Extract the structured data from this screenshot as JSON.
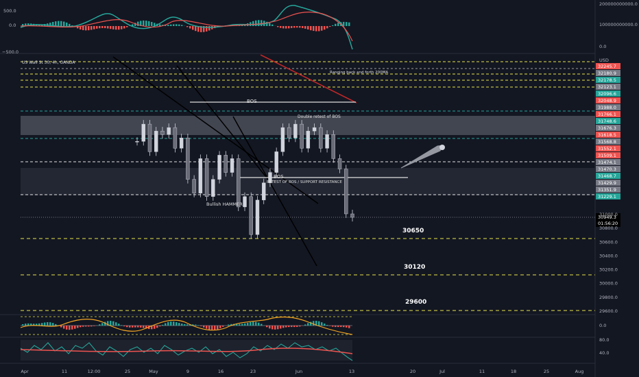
{
  "chart_data": {
    "type": "candlestick",
    "symbol": "US Wall St 30, 4h, OANDA",
    "currency": "USD",
    "x_axis_labels": [
      "Apr",
      "11",
      "12:00",
      "25",
      "May",
      "9",
      "16",
      "23",
      "Jun",
      "13",
      "20",
      "Jul",
      "11",
      "18",
      "25",
      "Aug"
    ],
    "price_axis_labels": [
      "31600.0",
      "31400.0",
      "31200.0",
      "31000.0",
      "30800.0",
      "30600.0",
      "30400.0",
      "30200.0",
      "30000.0",
      "29800.0",
      "29600.0"
    ],
    "price_tags": [
      {
        "label": "32245.7",
        "color": "#ef5350"
      },
      {
        "label": "32180.9",
        "color": "#787b86"
      },
      {
        "label": "32178.5",
        "color": "#26a69a"
      },
      {
        "label": "32123.1",
        "color": "#787b86"
      },
      {
        "label": "32096.6",
        "color": "#26a69a"
      },
      {
        "label": "32048.9",
        "color": "#ef5350"
      },
      {
        "label": "31988.0",
        "color": "#787b86"
      },
      {
        "label": "31766.1",
        "color": "#ef5350"
      },
      {
        "label": "31748.6",
        "color": "#26a69a"
      },
      {
        "label": "31676.3",
        "color": "#787b86"
      },
      {
        "label": "31618.5",
        "color": "#ef5350"
      },
      {
        "label": "31568.8",
        "color": "#787b86"
      },
      {
        "label": "31552.1",
        "color": "#ef5350"
      },
      {
        "label": "31509.1",
        "color": "#ef5350"
      },
      {
        "label": "31474.1",
        "color": "#787b86"
      },
      {
        "label": "31470.3",
        "color": "#787b86"
      },
      {
        "label": "31468.7",
        "color": "#26a69a"
      },
      {
        "label": "31429.9",
        "color": "#787b86"
      },
      {
        "label": "31351.9",
        "color": "#787b86"
      },
      {
        "label": "31229.1",
        "color": "#26a69a"
      }
    ],
    "current_price": "30949.3",
    "countdown": "01:56:20",
    "support_levels": [
      "30650",
      "30120",
      "29600"
    ],
    "annotations": {
      "bos_top": "BOS",
      "bos_mid": "BOS",
      "double_retest": "Double retest of BOS",
      "retest": "RETEST OF BOS / SUPPORT RESISTANCE",
      "hammer": "Bullish HAMMER",
      "ranging": "Ranging back and forth 200MA"
    },
    "macd": {
      "axis_labels": [
        "200000000000.0",
        "100000000000.0",
        "0.0"
      ],
      "left_labels": [
        "500.0",
        "0.0",
        "−500.0"
      ]
    },
    "oscillator": {
      "axis_label": "0.0"
    },
    "rsi": {
      "axis_labels": [
        "80.0",
        "40.0"
      ]
    },
    "price_path": [
      [
        "Apr 26",
        32050
      ],
      [
        "Apr 27",
        32300
      ],
      [
        "Apr 28",
        31900
      ],
      [
        "Apr 29",
        32200
      ],
      [
        "May 2",
        32150
      ],
      [
        "May 3",
        32250
      ],
      [
        "May 4",
        31950
      ],
      [
        "May 5",
        32100
      ],
      [
        "May 6",
        31500
      ],
      [
        "May 9",
        31300
      ],
      [
        "May 10",
        31800
      ],
      [
        "May 11",
        31250
      ],
      [
        "May 12",
        31500
      ],
      [
        "May 13",
        31850
      ],
      [
        "May 16",
        31600
      ],
      [
        "May 17",
        31800
      ],
      [
        "May 18",
        31100
      ],
      [
        "May 19",
        31250
      ],
      [
        "May 20",
        30700
      ],
      [
        "May 23",
        31200
      ],
      [
        "May 24",
        31450
      ],
      [
        "May 25",
        31600
      ],
      [
        "May 26",
        31900
      ],
      [
        "May 27",
        32250
      ],
      [
        "May 30",
        32100
      ],
      [
        "May 31",
        32300
      ],
      [
        "Jun 1",
        31950
      ],
      [
        "Jun 2",
        32200
      ],
      [
        "Jun 3",
        32250
      ],
      [
        "Jun 6",
        31950
      ],
      [
        "Jun 7",
        32150
      ],
      [
        "Jun 8",
        31800
      ],
      [
        "Jun 9",
        31650
      ],
      [
        "Jun 10",
        31000
      ],
      [
        "Jun 13",
        30950
      ]
    ]
  }
}
